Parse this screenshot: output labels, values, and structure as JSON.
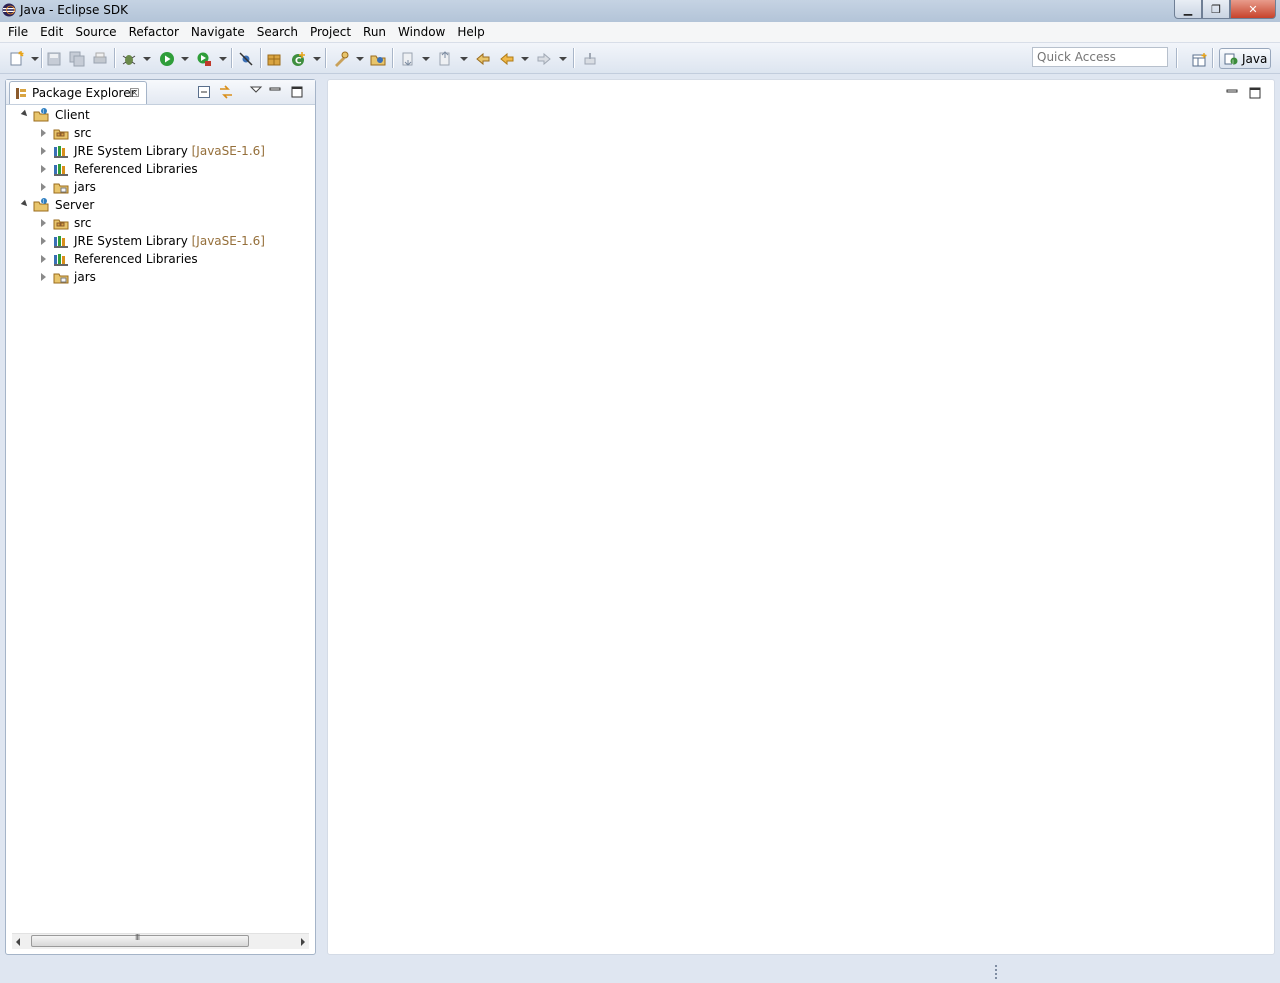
{
  "window": {
    "title": "Java - Eclipse SDK",
    "accent": "#b3c4d8"
  },
  "menu": [
    "File",
    "Edit",
    "Source",
    "Refactor",
    "Navigate",
    "Search",
    "Project",
    "Run",
    "Window",
    "Help"
  ],
  "toolbar": {
    "quick_access_placeholder": "Quick Access",
    "perspective_label": "Java"
  },
  "package_explorer": {
    "tab_label": "Package Explorer",
    "tab_close": "☒",
    "tree": [
      {
        "label": "Client",
        "expanded": true,
        "icon": "java-project-icon",
        "children": [
          {
            "label": "src",
            "icon": "source-folder-icon"
          },
          {
            "label": "JRE System Library",
            "decoration": "[JavaSE-1.6]",
            "icon": "library-icon"
          },
          {
            "label": "Referenced Libraries",
            "icon": "library-icon"
          },
          {
            "label": "jars",
            "icon": "folder-icon"
          }
        ]
      },
      {
        "label": "Server",
        "expanded": true,
        "icon": "java-project-icon",
        "children": [
          {
            "label": "src",
            "icon": "source-folder-icon"
          },
          {
            "label": "JRE System Library",
            "decoration": "[JavaSE-1.6]",
            "icon": "library-icon"
          },
          {
            "label": "Referenced Libraries",
            "icon": "library-icon"
          },
          {
            "label": "jars",
            "icon": "folder-icon"
          }
        ]
      }
    ],
    "scroll_grip": "III"
  }
}
